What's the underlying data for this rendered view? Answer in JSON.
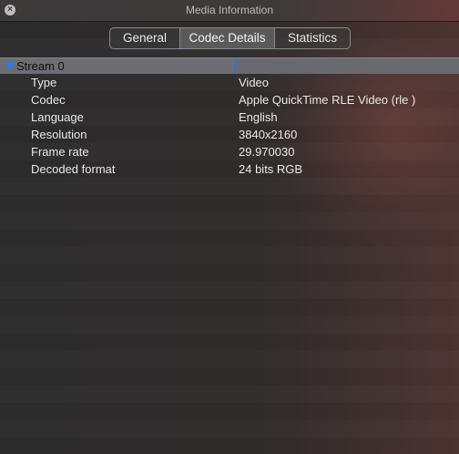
{
  "window": {
    "title": "Media Information",
    "close_symbol": "×"
  },
  "tabs": [
    {
      "label": "General",
      "active": false
    },
    {
      "label": "Codec Details",
      "active": true
    },
    {
      "label": "Statistics",
      "active": false
    }
  ],
  "stream": {
    "label": "Stream 0",
    "expanded": true,
    "rows": [
      {
        "label": "Type",
        "value": "Video"
      },
      {
        "label": "Codec",
        "value": "Apple QuickTime RLE Video (rle )"
      },
      {
        "label": "Language",
        "value": "English"
      },
      {
        "label": "Resolution",
        "value": "3840x2160"
      },
      {
        "label": "Frame rate",
        "value": "29.970030"
      },
      {
        "label": "Decoded format",
        "value": "24 bits RGB"
      }
    ]
  },
  "colors": {
    "accent": "#2f7ae5",
    "stream_row_bg": "#6c6d73",
    "text": "#e8e8e8"
  }
}
